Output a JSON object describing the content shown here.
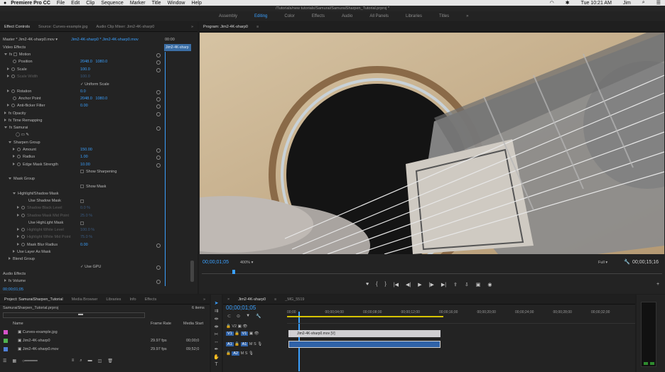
{
  "menubar": {
    "app_name": "Premiere Pro CC",
    "items": [
      "File",
      "Edit",
      "Clip",
      "Sequence",
      "Marker",
      "Title",
      "Window",
      "Help"
    ],
    "clock": "Tue 10:21 AM",
    "user": "Jim"
  },
  "window_path": "/Tutorials/new tutorials/Samurai/SamuraiSharpen_Tutorial.prproj *",
  "workspaces": [
    "Assembly",
    "Editing",
    "Color",
    "Effects",
    "Audio",
    "All Panels",
    "Libraries",
    "Titles"
  ],
  "active_workspace": "Editing",
  "effect_controls": {
    "tabs": [
      "Effect Controls",
      "Source: Curves-example.jpg",
      "Audio Clip Mixer: Jim2-4K-sharp0"
    ],
    "master_label": "Master * Jim2-4K-sharp0.mov",
    "clip_label": "Jim2-4K-sharp0 * Jim2-4K-sharp0.mov",
    "mini_timecode": "00:00",
    "mini_clip": "Jim2-4K-sharp",
    "video_effects_label": "Video Effects",
    "motion": "Motion",
    "position_label": "Position",
    "position_x": "2048.0",
    "position_y": "1080.0",
    "scale_label": "Scale",
    "scale_value": "100.0",
    "scale_width_label": "Scale Width",
    "scale_width_value": "100.0",
    "uniform_scale_label": "Uniform Scale",
    "rotation_label": "Rotation",
    "rotation_value": "0.0",
    "anchor_label": "Anchor Point",
    "anchor_x": "2048.0",
    "anchor_y": "1080.0",
    "antiflicker_label": "Anti-flicker Filter",
    "antiflicker_value": "0.00",
    "opacity": "Opacity",
    "time_remap": "Time Remapping",
    "samurai": "Samurai",
    "sharpen_group": "Sharpen Group",
    "amount_label": "Amount",
    "amount_value": "150.00",
    "radius_label": "Radius",
    "radius_value": "1.00",
    "edge_label": "Edge Mask Strength",
    "edge_value": "10.00",
    "show_sharpening": "Show Sharpening",
    "mask_group": "Mask Group",
    "show_mask": "Show Mask",
    "hl_shadow_mask": "Highlight/Shadow Mask",
    "use_shadow_mask": "Use Shadow Mask",
    "shadow_black_level": "Shadow Black Level",
    "shadow_black_value": "0.0 %",
    "shadow_mask_level": "Shadow Mask Mid Point",
    "shadow_mask_value": "25.0 %",
    "use_highlight_mask": "Use HighLight Mask",
    "highlight_white_level": "Highlight White Level",
    "highlight_white_value": "100.0 %",
    "highlight_mid": "Highlight White Mid Point",
    "highlight_mid_value": "75.0 %",
    "mask_blur_label": "Mask Blur Radius",
    "mask_blur_value": "0.00",
    "use_layer_as_mask": "Use Layer As Mask",
    "blend_group": "Blend Group",
    "use_gpu": "Use GPU",
    "audio_effects": "Audio Effects",
    "volume": "Volume",
    "timecode": "00;00;01;05"
  },
  "program": {
    "title": "Program: Jim2-4K-sharp0",
    "timecode": "00;00;01;05",
    "zoom": "400%",
    "resolution": "Full",
    "duration": "00;00;15;16"
  },
  "project": {
    "tabs": [
      "Project: SamuraiSharpen_Tutorial",
      "Media Browser",
      "Libraries",
      "Info",
      "Effects"
    ],
    "file": "SamuraiSharpen_Tutorial.prproj",
    "items_count": "6 items",
    "col_name": "Name",
    "col_fps": "Frame Rate",
    "col_start": "Media Start",
    "rows": [
      {
        "name": "Curves-example.jpg",
        "fps": "",
        "start": "",
        "color": "#d653c9"
      },
      {
        "name": "Jim2-4K-sharp0",
        "fps": "29.97 fps",
        "start": "00;00;0",
        "color": "#4fb24f"
      },
      {
        "name": "Jim2-4K-sharp0.mov",
        "fps": "29.97 fps",
        "start": "09;52;0",
        "color": "#4f7fd6"
      }
    ]
  },
  "timeline": {
    "tabs": [
      "Jim2-4K-sharp0",
      "_MG_5519"
    ],
    "timecode": "00;00;01;05",
    "ruler": [
      "00;00",
      "00;00;04;00",
      "00;00;08;00",
      "00;00;12;00",
      "00;00;16;00",
      "00;00;20;00",
      "00;00;24;00",
      "00;00;28;00",
      "00;00;32;00"
    ],
    "video_clip": "Jim2-4K-sharp0.mov [V]",
    "tracks": [
      "V2",
      "V1",
      "A1",
      "A2"
    ],
    "src_v": "V1",
    "src_a": "A1"
  },
  "colors": {
    "accent": "#3aa0ff",
    "video_clip": "#d0cfd2",
    "audio_clip": "#2f62a8",
    "playhead": "#3aa0ff"
  }
}
